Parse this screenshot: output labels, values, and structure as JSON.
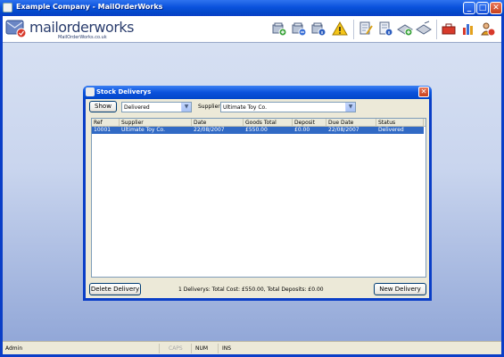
{
  "window": {
    "title": "Example Company - MailOrderWorks",
    "minimize": "_",
    "maximize": "□",
    "close": "✕"
  },
  "header": {
    "logo_text": "mailorderworks",
    "logo_sub": "MailOrderWorks.co.uk",
    "toolbar_icons": [
      "new-order-icon",
      "orders-icon",
      "order-info-icon",
      "warning-icon",
      "edit-stock-icon",
      "stock-info-icon",
      "stock-add-icon",
      "stock-ship-icon",
      "toolbox-icon",
      "reports-icon",
      "users-icon"
    ]
  },
  "dialog": {
    "title": "Stock Deliverys",
    "close": "✕",
    "show_button": "Show",
    "status_filter": "Delivered",
    "supplier_label": "Supplier",
    "supplier_value": "Ultimate Toy Co.",
    "columns": [
      "Ref",
      "Supplier",
      "Date",
      "Goods Total",
      "Deposit",
      "Due Date",
      "Status"
    ],
    "rows": [
      {
        "ref": "10001",
        "supplier": "Ultimate Toy Co.",
        "date": "22/08/2007",
        "goods_total": "£550.00",
        "deposit": "£0.00",
        "due_date": "22/08/2007",
        "status": "Delivered"
      }
    ],
    "delete_button": "Delete Delivery",
    "summary": "1 Deliverys: Total Cost: £550.00, Total Deposits: £0.00",
    "new_button": "New Delivery"
  },
  "status_bar": {
    "user": "Admin",
    "caps": "CAPS",
    "num": "NUM",
    "ins": "INS"
  },
  "colors": {
    "xp_blue": "#0a3ec7",
    "selection": "#316ac5"
  }
}
